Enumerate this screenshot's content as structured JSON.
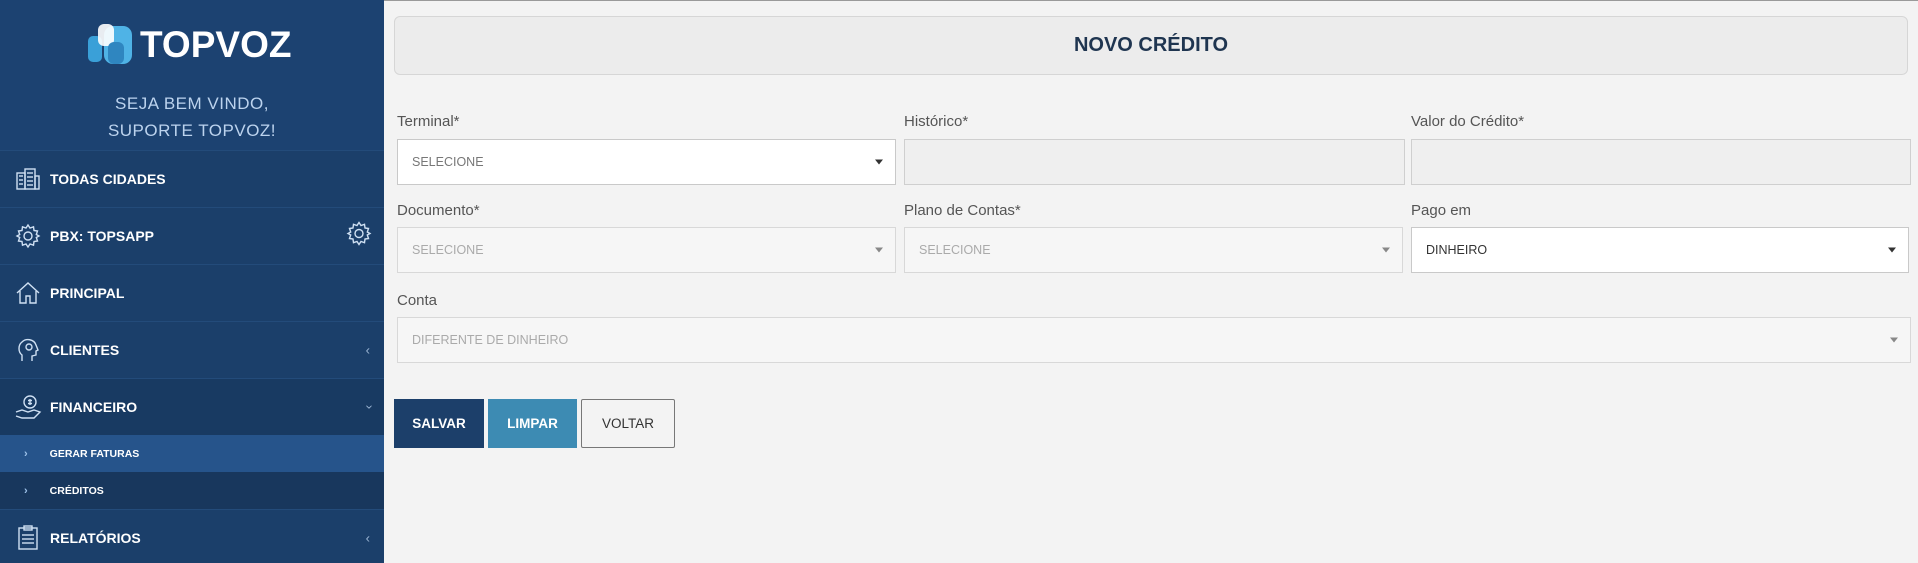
{
  "brand": {
    "logo_text": "TOPVOZ",
    "welcome_line1": "SEJA BEM VINDO,",
    "welcome_line2": "SUPORTE TOPVOZ!"
  },
  "sidebar": {
    "items": [
      {
        "label": "TODAS CIDADES",
        "icon": "building-icon"
      },
      {
        "label": "PBX: TOPSAPP",
        "icon": "gear-icon"
      },
      {
        "label": "PRINCIPAL",
        "icon": "home-icon"
      },
      {
        "label": "CLIENTES",
        "icon": "user-head-icon"
      },
      {
        "label": "FINANCEIRO",
        "icon": "money-hand-icon"
      },
      {
        "label": "RELATÓRIOS",
        "icon": "report-icon"
      }
    ],
    "subitems": [
      {
        "label": "GERAR FATURAS"
      },
      {
        "label": "CRÉDITOS"
      }
    ]
  },
  "page": {
    "title": "NOVO CRÉDITO"
  },
  "form": {
    "terminal_label": "Terminal*",
    "terminal_value": "SELECIONE",
    "historico_label": "Histórico*",
    "historico_value": "",
    "valor_label": "Valor do Crédito*",
    "valor_value": "",
    "documento_label": "Documento*",
    "documento_value": "SELECIONE",
    "plano_label": "Plano de Contas*",
    "plano_value": "SELECIONE",
    "pago_label": "Pago em",
    "pago_value": "DINHEIRO",
    "conta_label": "Conta",
    "conta_value": "DIFERENTE DE DINHEIRO"
  },
  "buttons": {
    "save": "SALVAR",
    "clear": "LIMPAR",
    "back": "VOLTAR"
  },
  "colors": {
    "sidebar": "#1b3f6a",
    "primary": "#1c3f6a",
    "accent": "#3d8bb3",
    "logo_blue": "#3aa0d8"
  }
}
